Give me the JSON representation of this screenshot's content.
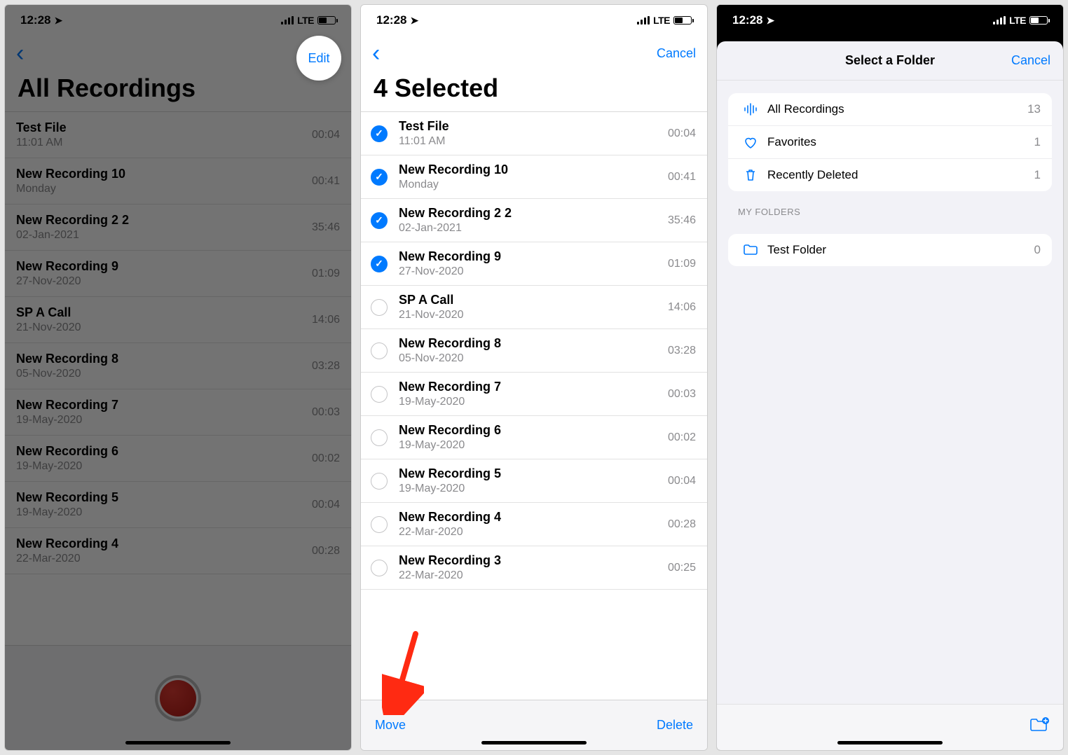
{
  "status": {
    "time": "12:28",
    "network": "LTE"
  },
  "screen1": {
    "title": "All Recordings",
    "edit_label": "Edit",
    "recordings": [
      {
        "title": "Test File",
        "sub": "11:01 AM",
        "dur": "00:04"
      },
      {
        "title": "New Recording 10",
        "sub": "Monday",
        "dur": "00:41"
      },
      {
        "title": "New Recording 2 2",
        "sub": "02-Jan-2021",
        "dur": "35:46"
      },
      {
        "title": "New Recording 9",
        "sub": "27-Nov-2020",
        "dur": "01:09"
      },
      {
        "title": "SP A Call",
        "sub": "21-Nov-2020",
        "dur": "14:06"
      },
      {
        "title": "New Recording 8",
        "sub": "05-Nov-2020",
        "dur": "03:28"
      },
      {
        "title": "New Recording 7",
        "sub": "19-May-2020",
        "dur": "00:03"
      },
      {
        "title": "New Recording 6",
        "sub": "19-May-2020",
        "dur": "00:02"
      },
      {
        "title": "New Recording 5",
        "sub": "19-May-2020",
        "dur": "00:04"
      },
      {
        "title": "New Recording 4",
        "sub": "22-Mar-2020",
        "dur": "00:28"
      }
    ]
  },
  "screen2": {
    "title": "4 Selected",
    "cancel_label": "Cancel",
    "move_label": "Move",
    "delete_label": "Delete",
    "recordings": [
      {
        "title": "Test File",
        "sub": "11:01 AM",
        "dur": "00:04",
        "checked": true
      },
      {
        "title": "New Recording 10",
        "sub": "Monday",
        "dur": "00:41",
        "checked": true
      },
      {
        "title": "New Recording 2 2",
        "sub": "02-Jan-2021",
        "dur": "35:46",
        "checked": true
      },
      {
        "title": "New Recording 9",
        "sub": "27-Nov-2020",
        "dur": "01:09",
        "checked": true
      },
      {
        "title": "SP A Call",
        "sub": "21-Nov-2020",
        "dur": "14:06",
        "checked": false
      },
      {
        "title": "New Recording 8",
        "sub": "05-Nov-2020",
        "dur": "03:28",
        "checked": false
      },
      {
        "title": "New Recording 7",
        "sub": "19-May-2020",
        "dur": "00:03",
        "checked": false
      },
      {
        "title": "New Recording 6",
        "sub": "19-May-2020",
        "dur": "00:02",
        "checked": false
      },
      {
        "title": "New Recording 5",
        "sub": "19-May-2020",
        "dur": "00:04",
        "checked": false
      },
      {
        "title": "New Recording 4",
        "sub": "22-Mar-2020",
        "dur": "00:28",
        "checked": false
      },
      {
        "title": "New Recording 3",
        "sub": "22-Mar-2020",
        "dur": "00:25",
        "checked": false
      }
    ]
  },
  "screen3": {
    "title": "Select a Folder",
    "cancel_label": "Cancel",
    "smart_folders": [
      {
        "icon": "waveform",
        "name": "All Recordings",
        "count": "13"
      },
      {
        "icon": "heart",
        "name": "Favorites",
        "count": "1"
      },
      {
        "icon": "trash",
        "name": "Recently Deleted",
        "count": "1"
      }
    ],
    "section_label": "MY FOLDERS",
    "user_folders": [
      {
        "icon": "folder",
        "name": "Test Folder",
        "count": "0"
      }
    ]
  }
}
